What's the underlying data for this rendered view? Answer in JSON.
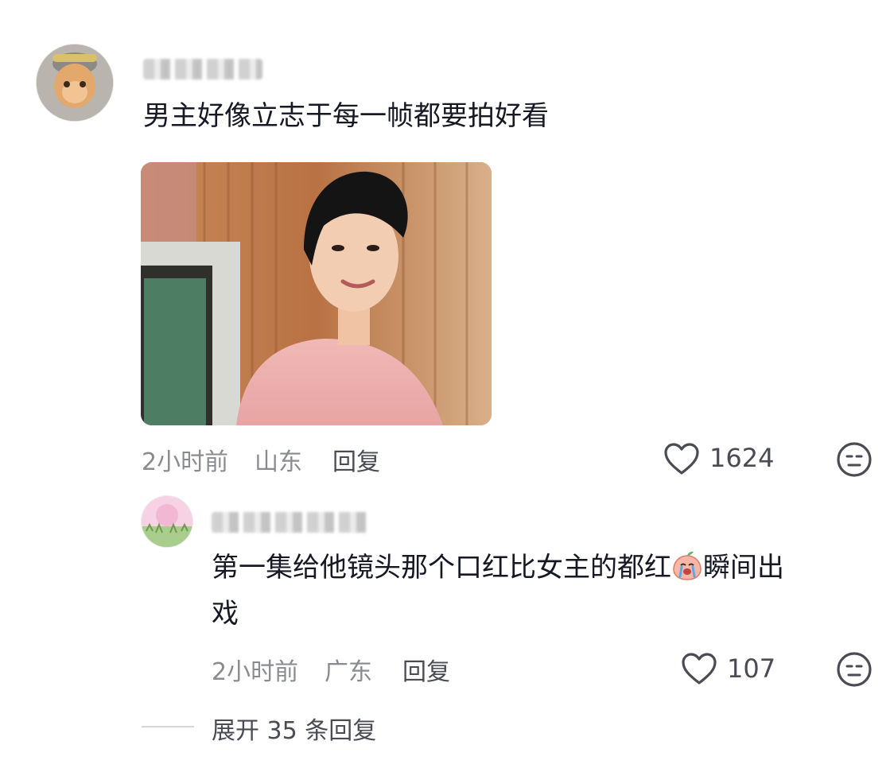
{
  "comment": {
    "text": "男主好像立志于每一帧都要拍好看",
    "time": "2小时前",
    "location": "山东",
    "reply_label": "回复",
    "likes": "1624"
  },
  "reply": {
    "text_before_emoji": "第一集给他镜头那个口红比女主的都红",
    "text_after_emoji": "瞬间出",
    "text_line2": "戏",
    "time": "2小时前",
    "location": "广东",
    "reply_label": "回复",
    "likes": "107"
  },
  "expand": {
    "label": "展开 35 条回复"
  },
  "icons": {
    "like": "heart-outline-icon",
    "dislike": "meh-face-icon",
    "emoji": "crying-peach-emoji"
  }
}
